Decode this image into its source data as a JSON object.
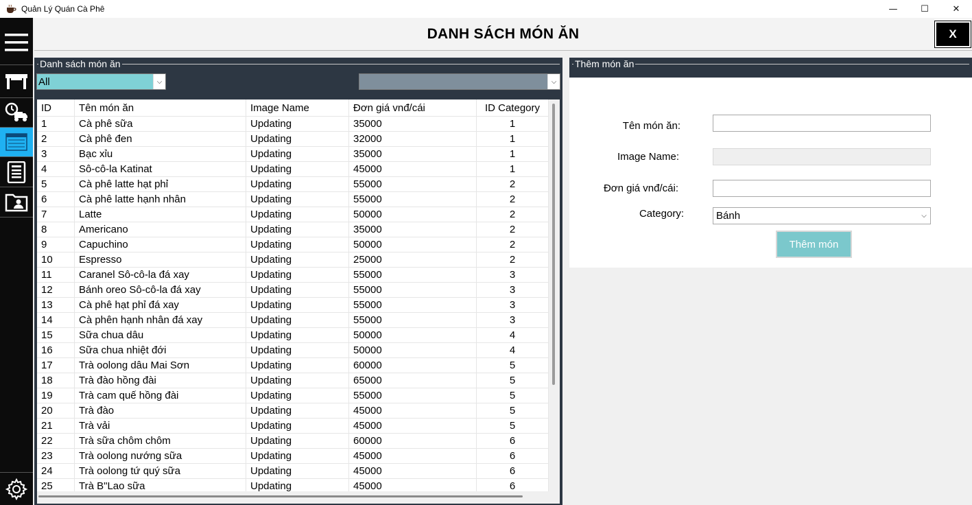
{
  "window": {
    "title": "Quản Lý Quán Cà Phê",
    "minimize": "—",
    "maximize": "☐",
    "close": "✕"
  },
  "sidebar": {
    "items": [
      {
        "icon": "menu-icon"
      },
      {
        "icon": "table-icon"
      },
      {
        "icon": "delivery-icon"
      },
      {
        "icon": "food-list-icon",
        "active": true
      },
      {
        "icon": "report-icon"
      },
      {
        "icon": "staff-folder-icon"
      },
      {
        "icon": "settings-gear-icon"
      }
    ]
  },
  "header": {
    "title": "DANH SÁCH MÓN ĂN",
    "close_label": "X"
  },
  "list_group": {
    "caption": "Danh sách món ăn",
    "filter_value": "All",
    "filter_color": "#7fd1d6",
    "second_combo_color": "#7f8f9c",
    "columns": [
      "ID",
      "Tên món ăn",
      "Image Name",
      "Đơn giá vnđ/cái",
      "ID Category"
    ],
    "rows": [
      [
        "1",
        "Cà phê sữa",
        "Updating",
        "35000",
        "1"
      ],
      [
        "2",
        "Cà phê đen",
        "Updating",
        "32000",
        "1"
      ],
      [
        "3",
        "Bạc xỉu",
        "Updating",
        "35000",
        "1"
      ],
      [
        "4",
        "Sô-cô-la Katinat",
        "Updating",
        "45000",
        "1"
      ],
      [
        "5",
        "Cà phê latte hạt phỉ",
        "Updating",
        "55000",
        "2"
      ],
      [
        "6",
        "Cà phê latte hạnh nhân",
        "Updating",
        "55000",
        "2"
      ],
      [
        "7",
        "Latte",
        "Updating",
        "50000",
        "2"
      ],
      [
        "8",
        "Americano",
        "Updating",
        "35000",
        "2"
      ],
      [
        "9",
        "Capuchino",
        "Updating",
        "50000",
        "2"
      ],
      [
        "10",
        "Espresso",
        "Updating",
        "25000",
        "2"
      ],
      [
        "11",
        "Caranel Sô-cô-la đá xay",
        "Updating",
        "55000",
        "3"
      ],
      [
        "12",
        "Bánh oreo Sô-cô-la đá xay",
        "Updating",
        "55000",
        "3"
      ],
      [
        "13",
        "Cà phê hạt phỉ đá xay",
        "Updating",
        "55000",
        "3"
      ],
      [
        "14",
        "Cà phên hạnh nhân đá xay",
        "Updating",
        "55000",
        "3"
      ],
      [
        "15",
        "Sữa chua dâu",
        "Updating",
        "50000",
        "4"
      ],
      [
        "16",
        "Sữa chua nhiệt đới",
        "Updating",
        "50000",
        "4"
      ],
      [
        "17",
        "Trà oolong dâu Mai Sơn",
        "Updating",
        "60000",
        "5"
      ],
      [
        "18",
        "Trà đào hồng đài",
        "Updating",
        "65000",
        "5"
      ],
      [
        "19",
        "Trà cam quế hồng đài",
        "Updating",
        "55000",
        "5"
      ],
      [
        "20",
        "Trà đào",
        "Updating",
        "45000",
        "5"
      ],
      [
        "21",
        "Trà vải",
        "Updating",
        "45000",
        "5"
      ],
      [
        "22",
        "Trà sữa chôm chôm",
        "Updating",
        "60000",
        "6"
      ],
      [
        "23",
        "Trà oolong nướng sữa",
        "Updating",
        "45000",
        "6"
      ],
      [
        "24",
        "Trà oolong tứ quý sữa",
        "Updating",
        "45000",
        "6"
      ],
      [
        "25",
        "Trà B\"Lao sữa",
        "Updating",
        "45000",
        "6"
      ]
    ]
  },
  "add_group": {
    "caption": "Thêm món ăn",
    "name_label": "Tên món ăn:",
    "name_value": "",
    "image_label": "Image Name:",
    "image_value": "",
    "price_label": "Đơn giá vnđ/cái:",
    "price_value": "",
    "category_label": "Category:",
    "category_value": "Bánh",
    "submit_label": "Thêm món",
    "submit_color": "#7bc8cc"
  }
}
